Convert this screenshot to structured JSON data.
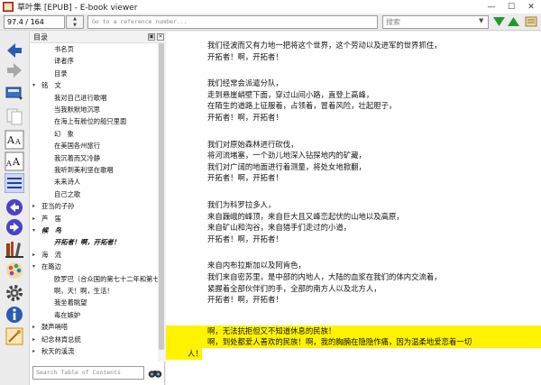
{
  "window": {
    "title": "草叶集 [EPUB] - E-book viewer",
    "minimize": "—",
    "maximize": "☐",
    "close": "✕"
  },
  "toolbar": {
    "position": "97.4 / 164",
    "reference_placeholder": "Go to a reference number...",
    "search_placeholder": "搜索"
  },
  "toc": {
    "header": "目录",
    "items": [
      {
        "label": "书名页",
        "level": 1
      },
      {
        "label": "译者序",
        "level": 1
      },
      {
        "label": "目录",
        "level": 1
      },
      {
        "label": "铭　文",
        "level": 0,
        "arrow": "▾"
      },
      {
        "label": "我对自己进行歌唱",
        "level": 2
      },
      {
        "label": "当我默默地沉思",
        "level": 2
      },
      {
        "label": "在海上有舱位的船只里面",
        "level": 2
      },
      {
        "label": "幻　象",
        "level": 2
      },
      {
        "label": "在美国各州旅行",
        "level": 2
      },
      {
        "label": "我沉着而又冷静",
        "level": 2
      },
      {
        "label": "我听到美利坚在歌唱",
        "level": 2
      },
      {
        "label": "未来诗人",
        "level": 2
      },
      {
        "label": "自己之歌",
        "level": 2
      },
      {
        "label": "亚当的子孙",
        "level": 0,
        "arrow": "▸"
      },
      {
        "label": "芦　笛",
        "level": 0,
        "arrow": "▸"
      },
      {
        "label": "候　鸟",
        "level": 0,
        "arrow": "▾",
        "current": true
      },
      {
        "label": "开拓者！啊，开拓者！",
        "level": 2,
        "current": true
      },
      {
        "label": "海　流",
        "level": 0,
        "arrow": "▸"
      },
      {
        "label": "在路边",
        "level": 0,
        "arrow": "▾"
      },
      {
        "label": "欧罗巴（合众国的第七十二年和第七十三年）",
        "level": 2
      },
      {
        "label": "啊，天！啊，生活！",
        "level": 2
      },
      {
        "label": "我坐着眺望",
        "level": 2
      },
      {
        "label": "毒在嫉妒",
        "level": 2
      },
      {
        "label": "鼓声哨嗒",
        "level": 0,
        "arrow": "▸"
      },
      {
        "label": "纪念林肯总统",
        "level": 0,
        "arrow": "▸"
      },
      {
        "label": "秋天的溪流",
        "level": 0,
        "arrow": "▸"
      }
    ],
    "search_placeholder": "Search Table of Contents"
  },
  "book": {
    "stanzas": [
      [
        "我们径波而又有力地一把将这个世界，这个劳动以及进军的世界抓住，",
        "开拓者！啊，开拓者！"
      ],
      [
        "我们经常会派遣分队，",
        "走到悬崖峭壁下面，穿过山间小路，直登上高峰，",
        "在陌生的道路上征服着，占领着，冒着风险，壮起胆子，",
        "开拓者！啊，开拓者！"
      ],
      [
        "我们对原始森林进行砍伐，",
        "将河流堵塞，一个劲儿地深入钻探地内的矿藏，",
        "我们对广阔的地面进行着测量，将处女地掀翻，",
        "开拓者！啊，开拓者！"
      ],
      [
        "我们为科罗拉多人，",
        "来自巍峨的峰顶，来自巨大且又峰峦起伏的山地以及高原，",
        "来自矿山和沟谷，来自猎手们走过的小道，",
        "开拓者！啊，开拓者！"
      ],
      [
        "来自内布拉斯加以及阿肯色，",
        "我们来自密苏里，是中部的内地人，大陆的血浆在我们的体内交流着，",
        "紧握着全部伙伴们的手，全部的南方人以及北方人，",
        "开拓者！啊，开拓者！"
      ]
    ],
    "highlighted": [
      "啊，无法抗拒但又不知道休息的民族！",
      "啊，到处都爱人善欢的民族！啊，我的胸腩在隐隐作痛，因为温柔地爱恋着一切",
      "人！"
    ]
  },
  "colors": {
    "highlight": "#fff300",
    "accent_blue": "#2a5db0",
    "accent_green": "#1f9a2e"
  }
}
